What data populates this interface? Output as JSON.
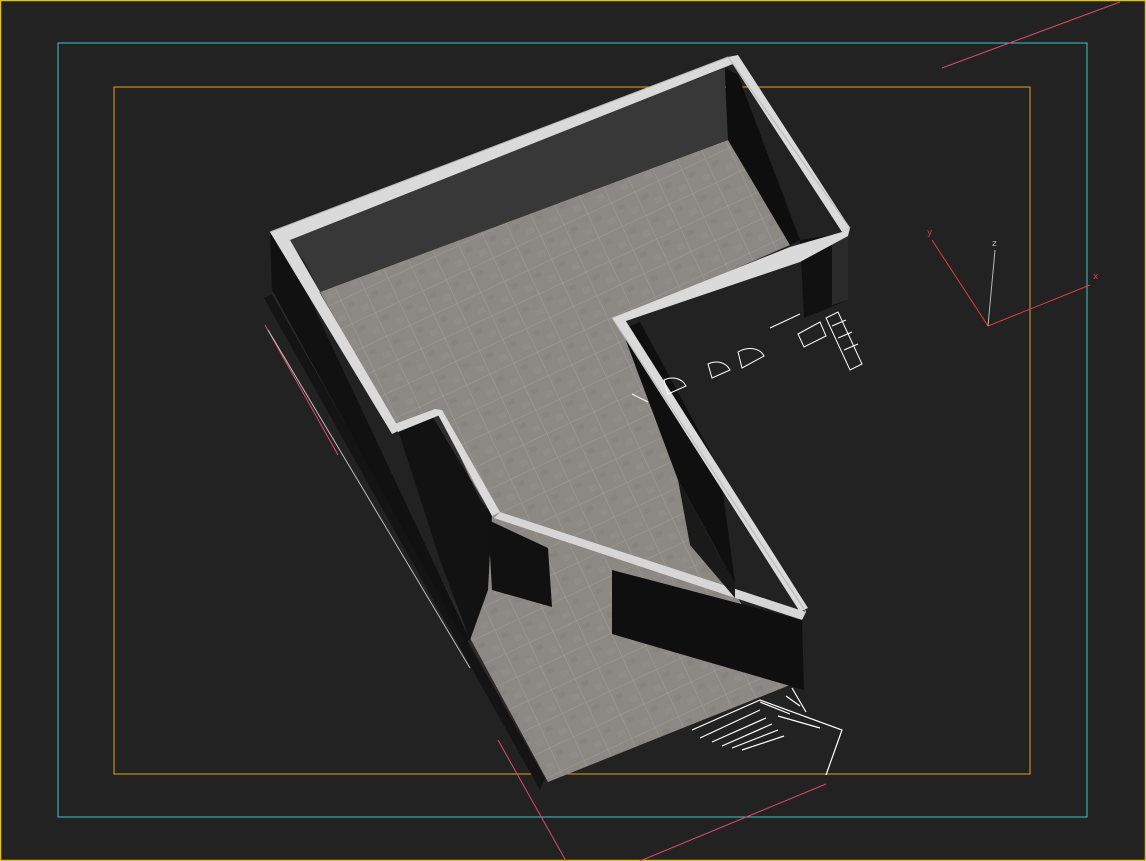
{
  "viewport": {
    "background": "#222222",
    "active_border_color": "#e0c020",
    "safe_frame_outer_color": "#3fc5c8",
    "safe_frame_inner_color": "#e6a020",
    "gizmo_line_color": "#d94a6a"
  },
  "axis_tripod": {
    "x_label": "x",
    "y_label": "y",
    "z_label": "z",
    "x_color": "#d94040",
    "y_color": "#d94040",
    "z_color": "#b8b8b8",
    "icon": "axis-tripod-icon"
  },
  "model": {
    "floor_color": "#8c8984",
    "wall_top_color": "#d9d9d9",
    "wall_side_color": "#111111",
    "wall_inner_color": "#353535"
  }
}
